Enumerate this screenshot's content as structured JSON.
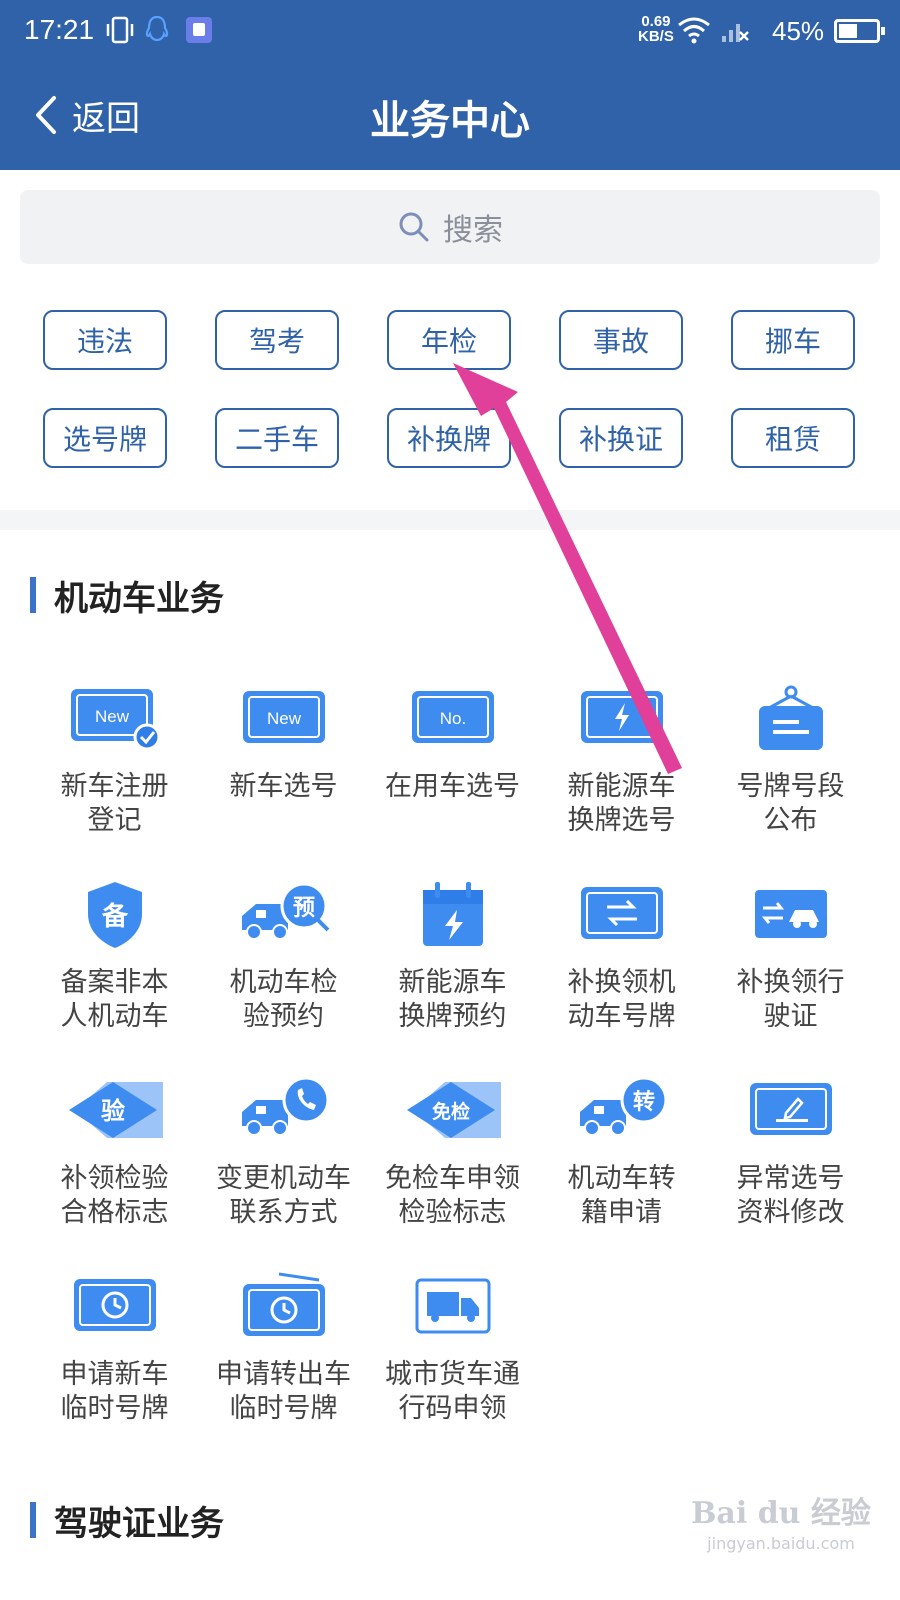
{
  "status_bar": {
    "time": "17:21",
    "net_speed_value": "0.69",
    "net_speed_unit": "KB/S",
    "battery": "45%",
    "icons": [
      "vibrate-icon",
      "qq-icon",
      "store-icon",
      "wifi-icon",
      "signal-off-icon",
      "battery-icon"
    ]
  },
  "header": {
    "back_label": "返回",
    "title": "业务中心"
  },
  "search": {
    "placeholder": "搜索"
  },
  "quick_tags": [
    "违法",
    "驾考",
    "年检",
    "事故",
    "挪车",
    "选号牌",
    "二手车",
    "补换牌",
    "补换证",
    "租赁"
  ],
  "sections": [
    {
      "title": "机动车业务",
      "items": [
        {
          "label": "新车注册\n登记",
          "icon": "new-plate-check-icon"
        },
        {
          "label": "新车选号",
          "icon": "new-plate-icon"
        },
        {
          "label": "在用车选号",
          "icon": "number-plate-icon"
        },
        {
          "label": "新能源车\n换牌选号",
          "icon": "energy-plate-icon"
        },
        {
          "label": "号牌号段\n公布",
          "icon": "hanging-sign-icon"
        },
        {
          "label": "备案非本\n人机动车",
          "icon": "shield-icon",
          "glyph": "备"
        },
        {
          "label": "机动车检\n验预约",
          "icon": "truck-booking-icon",
          "glyph": "预"
        },
        {
          "label": "新能源车\n换牌预约",
          "icon": "calendar-energy-icon"
        },
        {
          "label": "补换领机\n动车号牌",
          "icon": "plate-exchange-icon"
        },
        {
          "label": "补换领行\n驶证",
          "icon": "license-exchange-icon"
        },
        {
          "label": "补领检验\n合格标志",
          "icon": "diamond-tag-icon",
          "glyph": "验"
        },
        {
          "label": "变更机动车\n联系方式",
          "icon": "truck-phone-icon"
        },
        {
          "label": "免检车申领\n检验标志",
          "icon": "diamond-tag-icon",
          "glyph": "免检"
        },
        {
          "label": "机动车转\n籍申请",
          "icon": "truck-transfer-icon",
          "glyph": "转"
        },
        {
          "label": "异常选号\n资料修改",
          "icon": "plate-edit-icon"
        },
        {
          "label": "申请新车\n临时号牌",
          "icon": "clock-plate-icon"
        },
        {
          "label": "申请转出车\n临时号牌",
          "icon": "clock-plate-tilt-icon"
        },
        {
          "label": "城市货车通\n行码申领",
          "icon": "freight-truck-icon"
        }
      ]
    },
    {
      "title": "驾驶证业务",
      "items": []
    }
  ],
  "watermark": {
    "main": "Bai du 经验",
    "sub": "jingyan.baidu.com"
  },
  "colors": {
    "header_bg": "#2f62a8",
    "accent": "#3a73c8",
    "icon_blue": "#3f8cf0",
    "annotation_arrow": "#e0409a"
  }
}
